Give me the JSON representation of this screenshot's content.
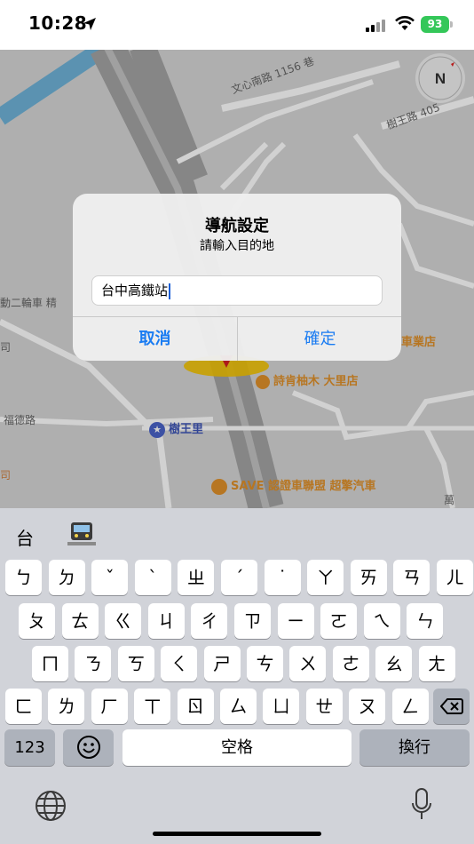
{
  "status": {
    "time": "10:28",
    "battery": "93"
  },
  "map": {
    "labels": [
      "文心南路 1156 巷",
      "樹王路 405",
      "動二輪車 精",
      "司",
      "福德路",
      "司",
      "萬"
    ],
    "pois": {
      "shop": "詩肯柚木 大里店",
      "station": "樹王里",
      "car": "SAVE 認證車聯盟 超擎汽車",
      "car_suffix": "車業店"
    },
    "compass": "N"
  },
  "dialog": {
    "title": "導航設定",
    "message": "請輸入目的地",
    "input_value": "台中高鐵站",
    "cancel": "取消",
    "ok": "確定"
  },
  "keyboard": {
    "candidates": [
      "台",
      "🚉"
    ],
    "row1": [
      "ㄅ",
      "ㄉ",
      "ˇ",
      "ˋ",
      "ㄓ",
      "ˊ",
      "˙",
      "ㄚ",
      "ㄞ",
      "ㄢ",
      "ㄦ"
    ],
    "row2": [
      "ㄆ",
      "ㄊ",
      "ㄍ",
      "ㄐ",
      "ㄔ",
      "ㄗ",
      "ㄧ",
      "ㄛ",
      "ㄟ",
      "ㄣ"
    ],
    "row3": [
      "ㄇ",
      "ㄋ",
      "ㄎ",
      "ㄑ",
      "ㄕ",
      "ㄘ",
      "ㄨ",
      "ㄜ",
      "ㄠ",
      "ㄤ"
    ],
    "row4": [
      "ㄈ",
      "ㄌ",
      "ㄏ",
      "ㄒ",
      "ㄖ",
      "ㄙ",
      "ㄩ",
      "ㄝ",
      "ㄡ",
      "ㄥ"
    ],
    "numbers": "123",
    "space": "空格",
    "return": "換行"
  },
  "colors": {
    "accent": "#1a7cf2",
    "battery": "#34c759",
    "map_bg": "#d6d6d6"
  }
}
